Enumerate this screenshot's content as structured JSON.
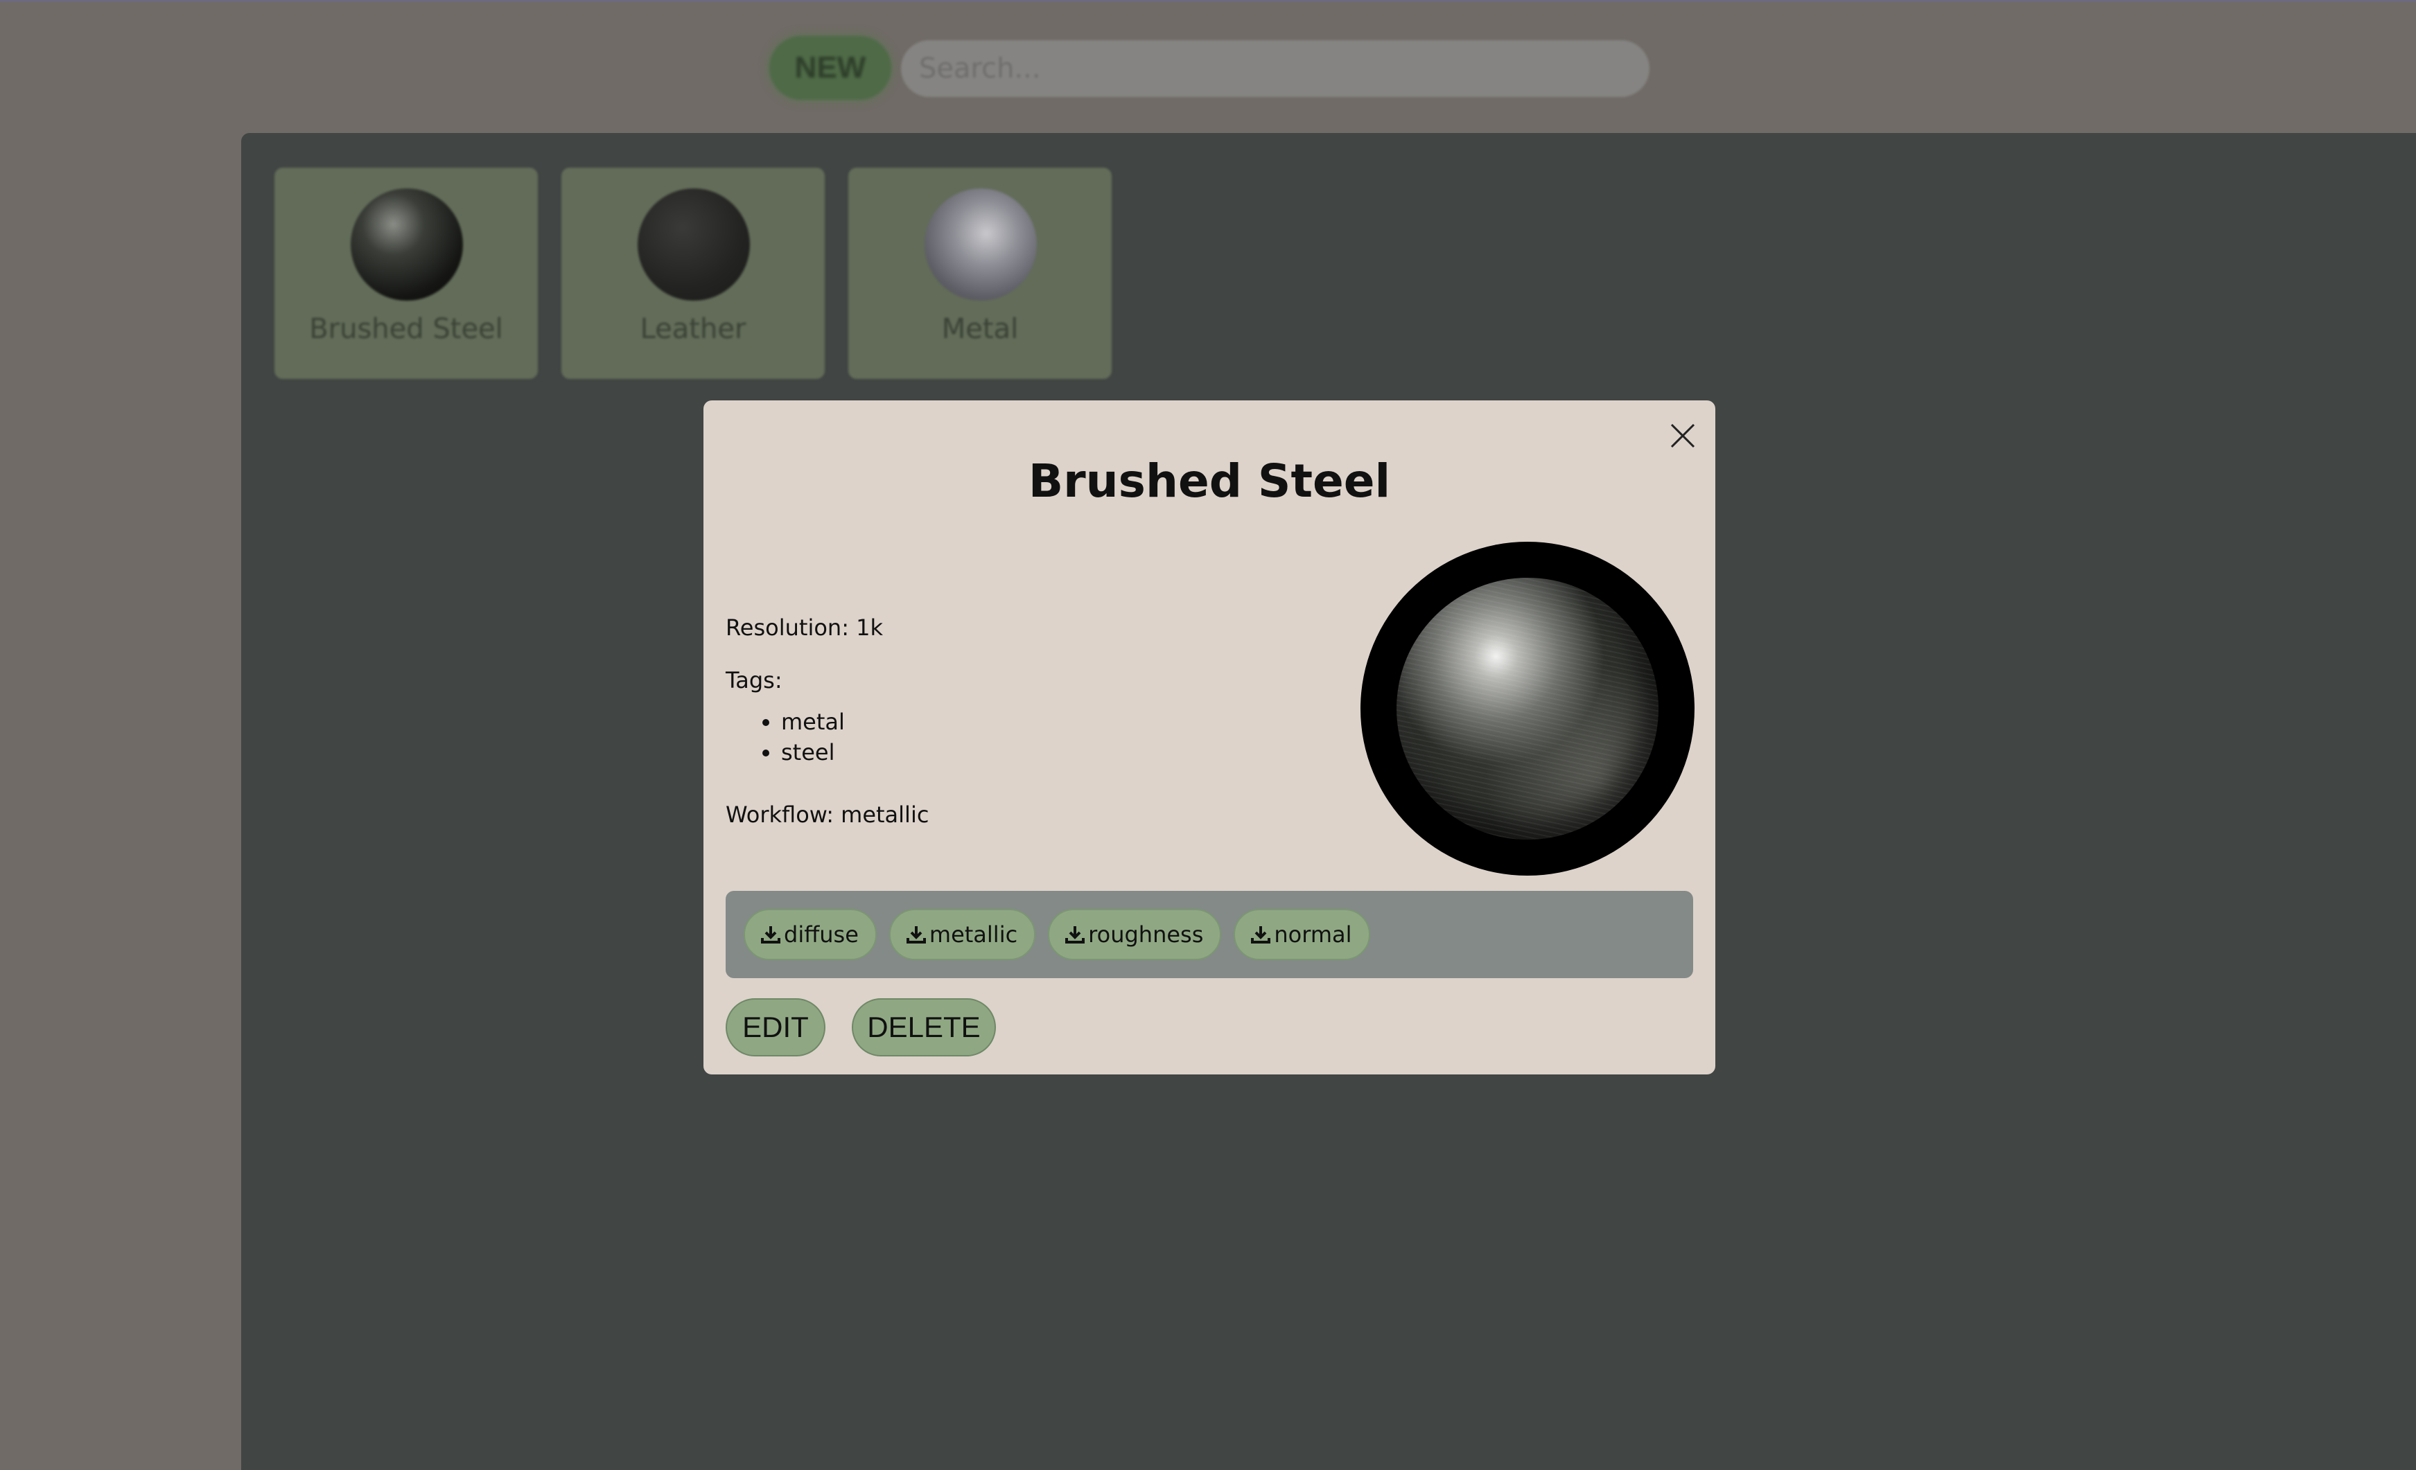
{
  "header": {
    "new_label": "NEW",
    "search_placeholder": "Search..."
  },
  "gallery": {
    "cards": [
      {
        "label": "Brushed Steel",
        "icon": "brushed-steel-sphere"
      },
      {
        "label": "Leather",
        "icon": "leather-sphere"
      },
      {
        "label": "Metal",
        "icon": "metal-sphere"
      }
    ]
  },
  "modal": {
    "title": "Brushed Steel",
    "resolution": "Resolution: 1k",
    "tags_label": "Tags:",
    "tags": [
      "metal",
      "steel"
    ],
    "workflow": "Workflow: metallic",
    "maps": [
      "diffuse",
      "metallic",
      "roughness",
      "normal"
    ],
    "download_icon": "download-icon",
    "close_icon": "close-icon",
    "edit_label": "EDIT",
    "delete_label": "DELETE"
  },
  "colors": {
    "modal_bg": "#ddd3cb",
    "button_green": "#8fa883",
    "maps_bar": "#838a88",
    "overlay_panel": "#414544"
  }
}
